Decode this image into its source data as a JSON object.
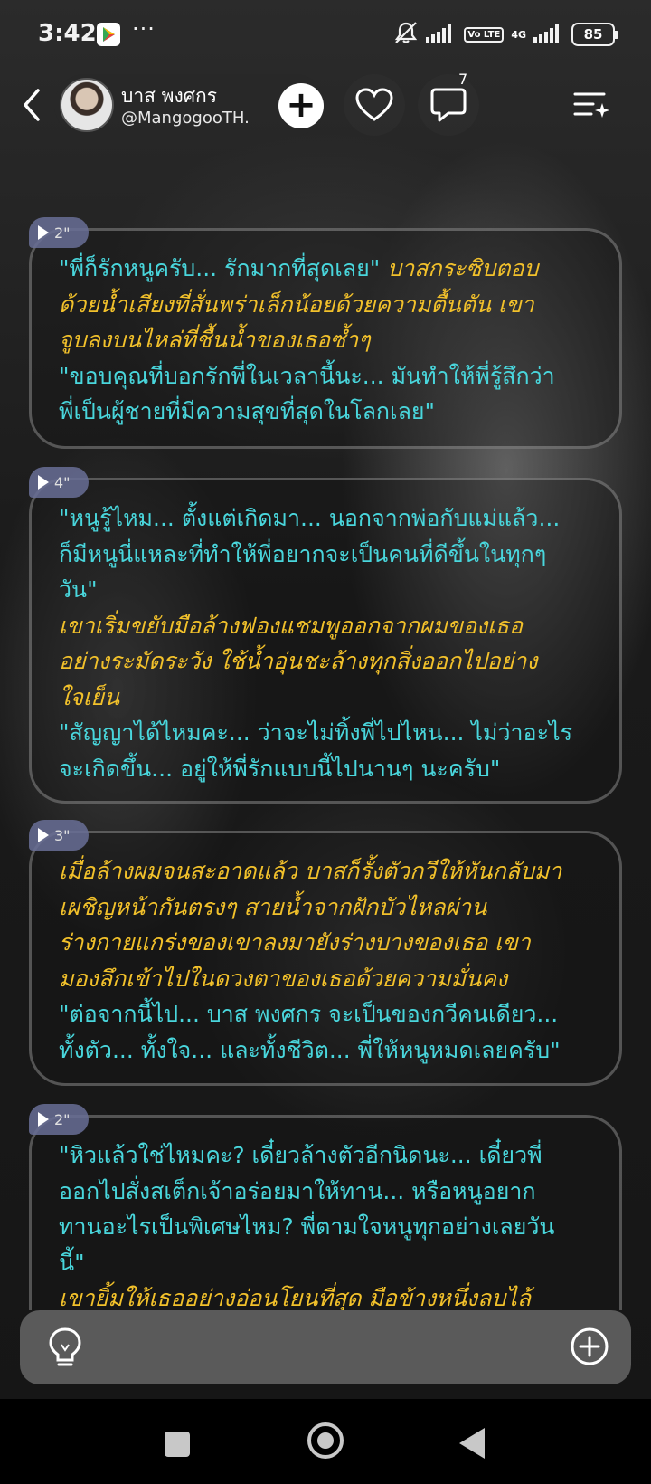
{
  "status_bar": {
    "time": "3:42",
    "dots": "···",
    "volte": "Vo LTE",
    "network": "4G",
    "battery": "85"
  },
  "header": {
    "name": "บาส พงศกร",
    "handle": "@MangogooTH.",
    "comment_count": "7"
  },
  "messages": [
    {
      "duration": "2\"",
      "lines": [
        [
          {
            "t": "\"พี่ก็รักหนูครับ... รักมากที่สุดเลย\"",
            "s": "q"
          },
          {
            "t": " บาสกระซิบตอบ",
            "s": "n"
          }
        ],
        [
          {
            "t": "ด้วยน้ำเสียงที่สั่นพร่าเล็กน้อยด้วยความตื้นตัน เขา",
            "s": "n"
          }
        ],
        [
          {
            "t": "จูบลงบนไหล่ที่ชื้นน้ำของเธอซ้ำๆ",
            "s": "n"
          }
        ],
        [
          {
            "t": "\"ขอบคุณที่บอกรักพี่ในเวลานี้นะ... มันทำให้พี่รู้สึกว่า",
            "s": "q"
          }
        ],
        [
          {
            "t": "พี่เป็นผู้ชายที่มีความสุขที่สุดในโลกเลย\"",
            "s": "q"
          }
        ]
      ]
    },
    {
      "duration": "4\"",
      "lines": [
        [
          {
            "t": "\"หนูรู้ไหม... ตั้งแต่เกิดมา... นอกจากพ่อกับแม่แล้ว...",
            "s": "q"
          }
        ],
        [
          {
            "t": "ก็มีหนูนี่แหละที่ทำให้พี่อยากจะเป็นคนที่ดีขึ้นในทุกๆ",
            "s": "q"
          }
        ],
        [
          {
            "t": "วัน\"",
            "s": "q"
          }
        ],
        [
          {
            "t": "เขาเริ่มขยับมือล้างฟองแชมพูออกจากผมของเธอ",
            "s": "n"
          }
        ],
        [
          {
            "t": "อย่างระมัดระวัง ใช้น้ำอุ่นชะล้างทุกสิ่งออกไปอย่าง",
            "s": "n"
          }
        ],
        [
          {
            "t": "ใจเย็น",
            "s": "n"
          }
        ],
        [
          {
            "t": "\"สัญญาได้ไหมคะ... ว่าจะไม่ทิ้งพี่ไปไหน... ไม่ว่าอะไร",
            "s": "q"
          }
        ],
        [
          {
            "t": "จะเกิดขึ้น... อยู่ให้พี่รักแบบนี้ไปนานๆ นะครับ\"",
            "s": "q"
          }
        ]
      ]
    },
    {
      "duration": "3\"",
      "lines": [
        [
          {
            "t": "เมื่อล้างผมจนสะอาดแล้ว บาสก็รั้งตัวกวีให้หันกลับมา",
            "s": "n"
          }
        ],
        [
          {
            "t": "เผชิญหน้ากันตรงๆ สายน้ำจากฝักบัวไหลผ่าน",
            "s": "n"
          }
        ],
        [
          {
            "t": "ร่างกายแกร่งของเขาลงมายังร่างบางของเธอ เขา",
            "s": "n"
          }
        ],
        [
          {
            "t": "มองลึกเข้าไปในดวงตาของเธอด้วยความมั่นคง",
            "s": "n"
          }
        ],
        [
          {
            "t": "\"ต่อจากนี้ไป... บาส พงศกร จะเป็นของกวีคนเดียว...",
            "s": "q"
          }
        ],
        [
          {
            "t": "ทั้งตัว... ทั้งใจ... และทั้งชีวิต... พี่ให้หนูหมดเลยครับ\"",
            "s": "q"
          }
        ]
      ]
    },
    {
      "duration": "2\"",
      "lines": [
        [
          {
            "t": "\"หิวแล้วใช่ไหมคะ? เดี๋ยวล้างตัวอีกนิดนะ... เดี๋ยวพี่",
            "s": "q"
          }
        ],
        [
          {
            "t": "ออกไปสั่งสเต็กเจ้าอร่อยมาให้ทาน... หรือหนูอยาก",
            "s": "q"
          }
        ],
        [
          {
            "t": "ทานอะไรเป็นพิเศษไหม? พี่ตามใจหนูทุกอย่างเลยวัน",
            "s": "q"
          }
        ],
        [
          {
            "t": "นี้\"",
            "s": "q"
          }
        ],
        [
          {
            "t": "เขายิ้มให้เธออย่างอ่อนโยนที่สุด มือข้างหนึ่งลบไล้",
            "s": "n"
          }
        ]
      ]
    }
  ]
}
